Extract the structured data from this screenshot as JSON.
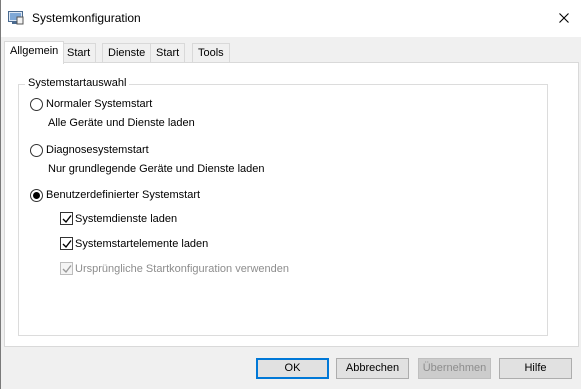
{
  "window": {
    "title": "Systemkonfiguration",
    "icon": "msconfig-icon"
  },
  "tabs": [
    {
      "label": "Allgemein",
      "active": true
    },
    {
      "label": "Start",
      "active": false
    },
    {
      "label": "Dienste",
      "active": false
    },
    {
      "label": "Start",
      "active": false
    },
    {
      "label": "Tools",
      "active": false
    }
  ],
  "group": {
    "title": "Systemstartauswahl"
  },
  "options": {
    "normal": {
      "label": "Normaler Systemstart",
      "description": "Alle Geräte und Dienste laden",
      "checked": false
    },
    "diagnostic": {
      "label": "Diagnosesystemstart",
      "description": "Nur grundlegende Geräte und Dienste laden",
      "checked": false
    },
    "custom": {
      "label": "Benutzerdefinierter Systemstart",
      "checked": true
    }
  },
  "custom_options": {
    "services": {
      "label": "Systemdienste laden",
      "checked": true,
      "enabled": true
    },
    "startup_items": {
      "label": "Systemstartelemente laden",
      "checked": true,
      "enabled": true
    },
    "original_config": {
      "label": "Ursprüngliche Startkonfiguration verwenden",
      "checked": true,
      "enabled": false
    }
  },
  "buttons": {
    "ok": "OK",
    "cancel": "Abbrechen",
    "apply": "Übernehmen",
    "help": "Hilfe"
  },
  "colors": {
    "accent": "#0078d7",
    "disabled_text": "#8d8d8d"
  }
}
